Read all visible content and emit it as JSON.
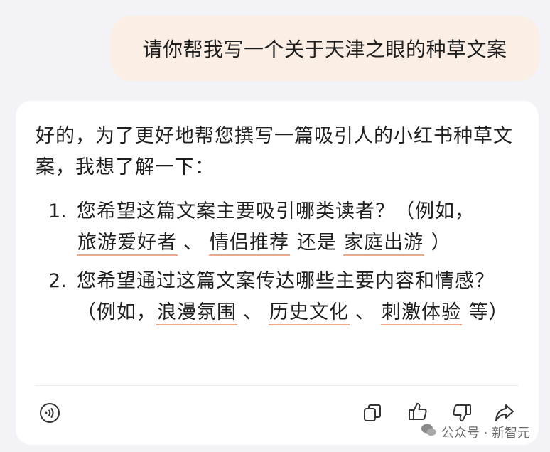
{
  "user_message": "请你帮我写一个关于天津之眼的种草文案",
  "reply": {
    "intro": "好的，为了更好地帮您撰写一篇吸引人的小红书种草文案，我想了解一下：",
    "questions": [
      {
        "num": "1.",
        "text_before": "您希望这篇文案主要吸引哪类读者？（例如，",
        "tag1": "旅游爱好者",
        "sep1": "、",
        "tag2": "情侣推荐",
        "mid": " 还是 ",
        "tag3": "家庭出游",
        "text_after": " ）"
      },
      {
        "num": "2.",
        "text_before": "您希望通过这篇文案传达哪些主要内容和情感？（例如，",
        "tag1": "浪漫氛围",
        "sep1": "、",
        "tag2": "历史文化",
        "sep2": "、",
        "tag3": "刺激体验",
        "text_after": " 等）"
      }
    ]
  },
  "actions": {
    "icons": [
      "speaker-icon",
      "copy-icon",
      "thumbs-up-icon",
      "thumbs-down-icon",
      "share-icon"
    ]
  },
  "watermark": {
    "text": "公众号 · 新智元",
    "icon": "wechat-icon"
  },
  "colors": {
    "background": "#f3f2f6",
    "user_bubble": "#fbeee4",
    "card": "#ffffff",
    "tag_underline": "#e8a98d"
  }
}
